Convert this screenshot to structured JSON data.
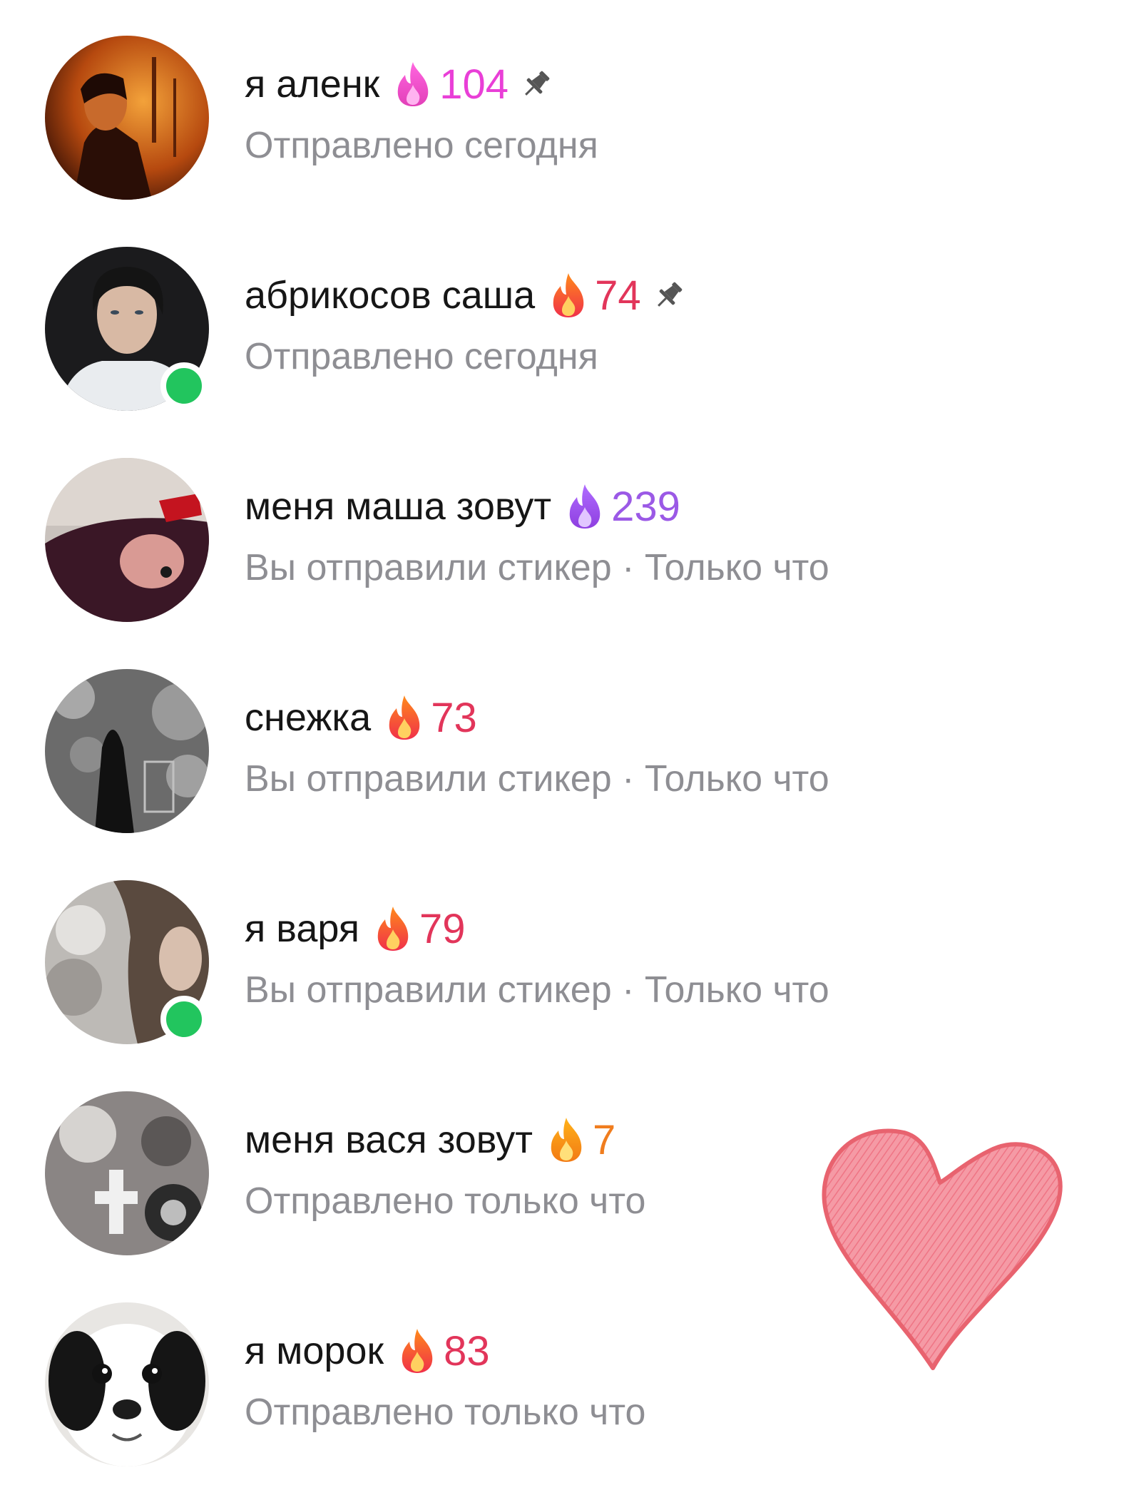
{
  "colors": {
    "pink_counter": "#e93fd7",
    "red_counter": "#e2355a",
    "purple_counter": "#9b59e6",
    "orange_counter": "#f07d1e",
    "subtitle": "#8e8e93",
    "online": "#22c55e",
    "heart": "#f27f8c"
  },
  "chats": [
    {
      "name": "я аленк",
      "flame": "pink-flame-icon",
      "streak": "104",
      "pinned": true,
      "online": false,
      "subtitle": "Отправлено сегодня"
    },
    {
      "name": "абрикосов саша",
      "flame": "red-flame-icon",
      "streak": "74",
      "pinned": true,
      "online": true,
      "subtitle": "Отправлено сегодня"
    },
    {
      "name": "меня маша зовут",
      "flame": "purple-flame-icon",
      "streak": "239",
      "pinned": false,
      "online": false,
      "subtitle": "Вы отправили стикер · Только что"
    },
    {
      "name": "снежка",
      "flame": "red-flame-icon",
      "streak": "73",
      "pinned": false,
      "online": false,
      "subtitle": "Вы отправили стикер · Только что"
    },
    {
      "name": "я варя",
      "flame": "red-flame-icon",
      "streak": "79",
      "pinned": false,
      "online": true,
      "subtitle": "Вы отправили стикер · Только что"
    },
    {
      "name": "меня вася зовут",
      "flame": "orange-flame-icon",
      "streak": "7",
      "pinned": false,
      "online": false,
      "subtitle": "Отправлено только что"
    },
    {
      "name": "я морок",
      "flame": "red-flame-icon",
      "streak": "83",
      "pinned": false,
      "online": false,
      "subtitle": "Отправлено только что"
    }
  ],
  "sticker": {
    "icon": "heart-sticker-icon"
  }
}
